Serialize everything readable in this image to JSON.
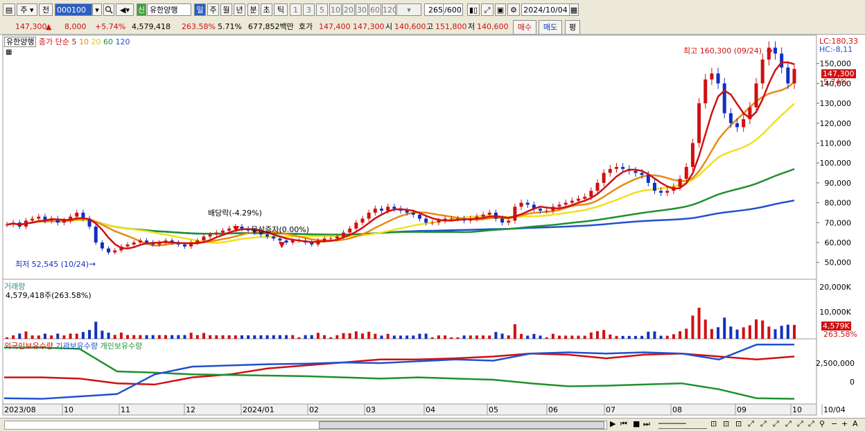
{
  "toolbar": {
    "type_select": "주",
    "prev": "전",
    "code": "000100",
    "name": "유한양행",
    "new_badge": "신",
    "periods": [
      "일",
      "주",
      "월",
      "년",
      "분",
      "초",
      "틱"
    ],
    "minute_opts": [
      "1",
      "3",
      "5",
      "10",
      "20",
      "30",
      "60",
      "120"
    ],
    "count": "265",
    "count_total": "/600",
    "date": "2024/10/04"
  },
  "quote": {
    "price": "147,300",
    "arrow": "▲",
    "change": "8,000",
    "change_pct": "+5.74%",
    "volume": "4,579,418",
    "vol_ratio": "263.58%",
    "turnover": "5.71%",
    "value": "677,852백만",
    "ask_label": "호가",
    "ask": "147,400",
    "bid": "147,300",
    "open_label": "시",
    "open": "140,600",
    "high_label": "고",
    "high": "151,800",
    "low_label": "저",
    "low": "140,600",
    "buy": "매수",
    "sell": "매도",
    "avg": "평"
  },
  "price_panel": {
    "name": "유한양행",
    "ma_label": "종가 단순",
    "ma": [
      "5",
      "10",
      "20",
      "60",
      "120"
    ],
    "ma_colors": [
      "#d01010",
      "#e88a10",
      "#f0e020",
      "#1e9030",
      "#2050d0"
    ],
    "lc": "LC:180,33",
    "hc": "HC:-8,11",
    "y_ticks": [
      "150,000",
      "140,000",
      "130,000",
      "120,000",
      "110,000",
      "100,000",
      "90,000",
      "80,000",
      "70,000",
      "60,000",
      "50,000"
    ],
    "cur_price": "147,300",
    "cur_pct": "5.74%",
    "ann_high": "최고 160,300 (09/24)",
    "ann_low": "최저 52,545 (10/24)",
    "ann_div": "배당락(-4.29%)",
    "ann_bonus": "무상증자(0.00%)"
  },
  "volume_panel": {
    "title": "거래량",
    "info": "4,579,418주(263.58%)",
    "y_ticks": [
      "20,000K",
      "10,000K"
    ],
    "cur": "4,579K",
    "cur_pct": "263.58%"
  },
  "holding_panel": {
    "series": [
      "외국인보유수량",
      "기관보유수량",
      "개인보유수량"
    ],
    "colors": [
      "#d01010",
      "#2050d0",
      "#1e9030"
    ],
    "y_ticks": [
      "2,500,000",
      "0"
    ]
  },
  "x_labels": [
    "2023/08",
    "10",
    "11",
    "12",
    "2024/01",
    "02",
    "03",
    "04",
    "05",
    "06",
    "07",
    "08",
    "09",
    "10",
    "10/04"
  ],
  "chart_data": {
    "type": "candlestick",
    "x_start": "2023/08",
    "x_end": "2024/10/04",
    "close": [
      69000,
      70000,
      68000,
      71000,
      72000,
      73000,
      71000,
      72000,
      70000,
      71000,
      73000,
      75000,
      72000,
      68000,
      60000,
      57000,
      55000,
      56000,
      58000,
      59000,
      60000,
      61000,
      60000,
      59000,
      60000,
      61000,
      60000,
      59000,
      58000,
      60000,
      61000,
      63000,
      64000,
      65000,
      66000,
      67000,
      68000,
      67000,
      66000,
      65000,
      64000,
      63000,
      62000,
      61000,
      60000,
      61000,
      61000,
      60000,
      59000,
      61000,
      62000,
      62000,
      63000,
      65000,
      67000,
      70000,
      72000,
      75000,
      77000,
      76000,
      78000,
      77000,
      76000,
      75000,
      74000,
      72000,
      70000,
      70000,
      71000,
      72000,
      72000,
      72000,
      71000,
      72000,
      73000,
      74000,
      75000,
      72000,
      70000,
      71000,
      78000,
      80000,
      79000,
      77000,
      76000,
      76000,
      78000,
      79000,
      80000,
      81000,
      82000,
      83000,
      86000,
      90000,
      95000,
      97000,
      98000,
      97000,
      96000,
      95000,
      94000,
      90000,
      86000,
      85000,
      86000,
      88000,
      92000,
      98000,
      110000,
      130000,
      142000,
      145000,
      140000,
      125000,
      120000,
      118000,
      122000,
      128000,
      140000,
      152000,
      158000,
      155000,
      148000,
      140000,
      147300
    ],
    "volume_note": "daily volume in K shares, max ~20,000K"
  }
}
